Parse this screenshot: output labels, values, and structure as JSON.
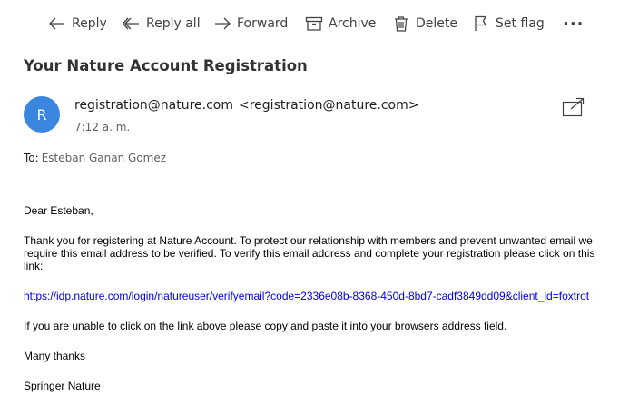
{
  "toolbar": {
    "reply": "Reply",
    "reply_all": "Reply all",
    "forward": "Forward",
    "archive": "Archive",
    "delete": "Delete",
    "set_flag": "Set flag",
    "more": "···"
  },
  "email": {
    "subject": "Your Nature Account Registration",
    "sender_initial": "R",
    "sender_name": "registration@nature.com",
    "sender_address": "<registration@nature.com>",
    "time": "7:12 a. m.",
    "to_label": "To:",
    "to_name": "Esteban Ganan Gomez"
  },
  "message": {
    "greeting": "Dear Esteban,",
    "para1": "Thank you for registering at Nature Account. To protect our relationship with members and prevent unwanted email we require this email address to be verified. To verify this email address and complete your registration please click on this link:",
    "link": "https://idp.nature.com/login/natureuser/verifyemail?code=2336e08b-8368-450d-8bd7-cadf3849dd09&client_id=foxtrot",
    "para2": "If you are unable to click on the link above please copy and paste it into your browsers address field.",
    "thanks": "Many thanks",
    "signature": "Springer Nature"
  },
  "colors": {
    "avatar": "#3b86e0",
    "link": "#0000ee"
  }
}
